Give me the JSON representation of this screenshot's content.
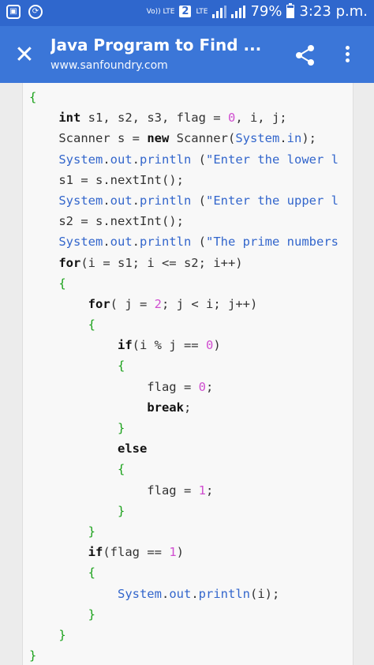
{
  "status_bar": {
    "volte": "Vo)) LTE",
    "sim": "2",
    "lte": "LTE",
    "battery_percent": "79%",
    "battery_fraction": 0.79,
    "time": "3:23 p.m.",
    "left_icons": [
      "screenshot-icon",
      "sync-icon"
    ]
  },
  "app_bar": {
    "close_glyph": "✕",
    "title": "Java Program to Find ...",
    "url": "www.sanfoundry.com",
    "icons": [
      "close-icon",
      "share-icon",
      "more-vert-icon"
    ]
  },
  "colors": {
    "app_bar": "#3b76d8",
    "status_bar": "#2f67cd",
    "keyword": "#111111",
    "number": "#d04ed0",
    "brace": "#1aa11a",
    "identifier": "#3366cc"
  },
  "code_lines": [
    [
      {
        "t": "{",
        "c": "br"
      }
    ],
    [
      {
        "t": "    "
      },
      {
        "t": "int",
        "c": "kw"
      },
      {
        "t": " s1, s2, s3, flag = "
      },
      {
        "t": "0",
        "c": "num"
      },
      {
        "t": ", i, j;"
      }
    ],
    [
      {
        "t": "    Scanner s = "
      },
      {
        "t": "new",
        "c": "kw"
      },
      {
        "t": " Scanner("
      },
      {
        "t": "System",
        "c": "id"
      },
      {
        "t": "."
      },
      {
        "t": "in",
        "c": "id"
      },
      {
        "t": ");"
      }
    ],
    [
      {
        "t": "    "
      },
      {
        "t": "System",
        "c": "id"
      },
      {
        "t": "."
      },
      {
        "t": "out",
        "c": "id"
      },
      {
        "t": "."
      },
      {
        "t": "println",
        "c": "id"
      },
      {
        "t": " ("
      },
      {
        "t": "\"Enter the lower l",
        "c": "str"
      }
    ],
    [
      {
        "t": "    s1 = s.nextInt();"
      }
    ],
    [
      {
        "t": "    "
      },
      {
        "t": "System",
        "c": "id"
      },
      {
        "t": "."
      },
      {
        "t": "out",
        "c": "id"
      },
      {
        "t": "."
      },
      {
        "t": "println",
        "c": "id"
      },
      {
        "t": " ("
      },
      {
        "t": "\"Enter the upper l",
        "c": "str"
      }
    ],
    [
      {
        "t": "    s2 = s.nextInt();"
      }
    ],
    [
      {
        "t": "    "
      },
      {
        "t": "System",
        "c": "id"
      },
      {
        "t": "."
      },
      {
        "t": "out",
        "c": "id"
      },
      {
        "t": "."
      },
      {
        "t": "println",
        "c": "id"
      },
      {
        "t": " ("
      },
      {
        "t": "\"The prime numbers",
        "c": "str"
      }
    ],
    [
      {
        "t": "    "
      },
      {
        "t": "for",
        "c": "kw"
      },
      {
        "t": "(i = s1; i <= s2; i++)"
      }
    ],
    [
      {
        "t": "    "
      },
      {
        "t": "{",
        "c": "br"
      }
    ],
    [
      {
        "t": "        "
      },
      {
        "t": "for",
        "c": "kw"
      },
      {
        "t": "( j = "
      },
      {
        "t": "2",
        "c": "num"
      },
      {
        "t": "; j < i; j++)"
      }
    ],
    [
      {
        "t": "        "
      },
      {
        "t": "{",
        "c": "br"
      }
    ],
    [
      {
        "t": "            "
      },
      {
        "t": "if",
        "c": "kw"
      },
      {
        "t": "(i % j == "
      },
      {
        "t": "0",
        "c": "num"
      },
      {
        "t": ")"
      }
    ],
    [
      {
        "t": "            "
      },
      {
        "t": "{",
        "c": "br"
      }
    ],
    [
      {
        "t": "                flag = "
      },
      {
        "t": "0",
        "c": "num"
      },
      {
        "t": ";"
      }
    ],
    [
      {
        "t": "                "
      },
      {
        "t": "break",
        "c": "kw"
      },
      {
        "t": ";"
      }
    ],
    [
      {
        "t": "            "
      },
      {
        "t": "}",
        "c": "br"
      }
    ],
    [
      {
        "t": "            "
      },
      {
        "t": "else",
        "c": "kw"
      }
    ],
    [
      {
        "t": "            "
      },
      {
        "t": "{",
        "c": "br"
      }
    ],
    [
      {
        "t": "                flag = "
      },
      {
        "t": "1",
        "c": "num"
      },
      {
        "t": ";"
      }
    ],
    [
      {
        "t": "            "
      },
      {
        "t": "}",
        "c": "br"
      }
    ],
    [
      {
        "t": "        "
      },
      {
        "t": "}",
        "c": "br"
      }
    ],
    [
      {
        "t": "        "
      },
      {
        "t": "if",
        "c": "kw"
      },
      {
        "t": "(flag == "
      },
      {
        "t": "1",
        "c": "num"
      },
      {
        "t": ")"
      }
    ],
    [
      {
        "t": "        "
      },
      {
        "t": "{",
        "c": "br"
      }
    ],
    [
      {
        "t": "            "
      },
      {
        "t": "System",
        "c": "id"
      },
      {
        "t": "."
      },
      {
        "t": "out",
        "c": "id"
      },
      {
        "t": "."
      },
      {
        "t": "println",
        "c": "id"
      },
      {
        "t": "(i);"
      }
    ],
    [
      {
        "t": "        "
      },
      {
        "t": "}",
        "c": "br"
      }
    ],
    [
      {
        "t": "    "
      },
      {
        "t": "}",
        "c": "br"
      }
    ],
    [
      {
        "t": "}",
        "c": "br"
      }
    ]
  ]
}
